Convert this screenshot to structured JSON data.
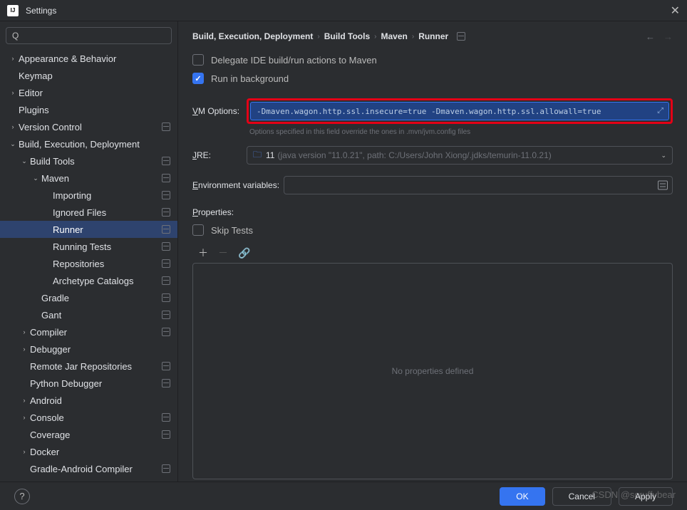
{
  "window": {
    "title": "Settings",
    "app_icon_text": "IJ"
  },
  "search": {
    "placeholder": ""
  },
  "tree": {
    "appearance": "Appearance & Behavior",
    "keymap": "Keymap",
    "editor": "Editor",
    "plugins": "Plugins",
    "version_control": "Version Control",
    "bed": "Build, Execution, Deployment",
    "build_tools": "Build Tools",
    "maven": "Maven",
    "importing": "Importing",
    "ignored": "Ignored Files",
    "runner": "Runner",
    "running_tests": "Running Tests",
    "repositories": "Repositories",
    "archetype": "Archetype Catalogs",
    "gradle": "Gradle",
    "gant": "Gant",
    "compiler": "Compiler",
    "debugger": "Debugger",
    "remote_jar": "Remote Jar Repositories",
    "python_debugger": "Python Debugger",
    "android": "Android",
    "console": "Console",
    "coverage": "Coverage",
    "docker": "Docker",
    "gradle_android": "Gradle-Android Compiler"
  },
  "breadcrumb": {
    "a": "Build, Execution, Deployment",
    "b": "Build Tools",
    "c": "Maven",
    "d": "Runner"
  },
  "form": {
    "delegate_label": "Delegate IDE build/run actions to Maven",
    "run_bg_label": "Run in background",
    "vm_label": "VM Options:",
    "vm_value": "-Dmaven.wagon.http.ssl.insecure=true -Dmaven.wagon.http.ssl.allowall=true",
    "vm_hint": "Options specified in this field override the ones in .mvn/jvm.config files",
    "jre_label": "JRE:",
    "jre_version": "11",
    "jre_detail": "(java version \"11.0.21\", path: C:/Users/John Xiong/.jdks/temurin-11.0.21)",
    "env_label": "Environment variables:",
    "properties_label": "Properties:",
    "skip_tests": "Skip Tests",
    "no_props": "No properties defined"
  },
  "footer": {
    "ok": "OK",
    "cancel": "Cancel",
    "apply": "Apply"
  },
  "watermark": "CSDN @scruffybear"
}
